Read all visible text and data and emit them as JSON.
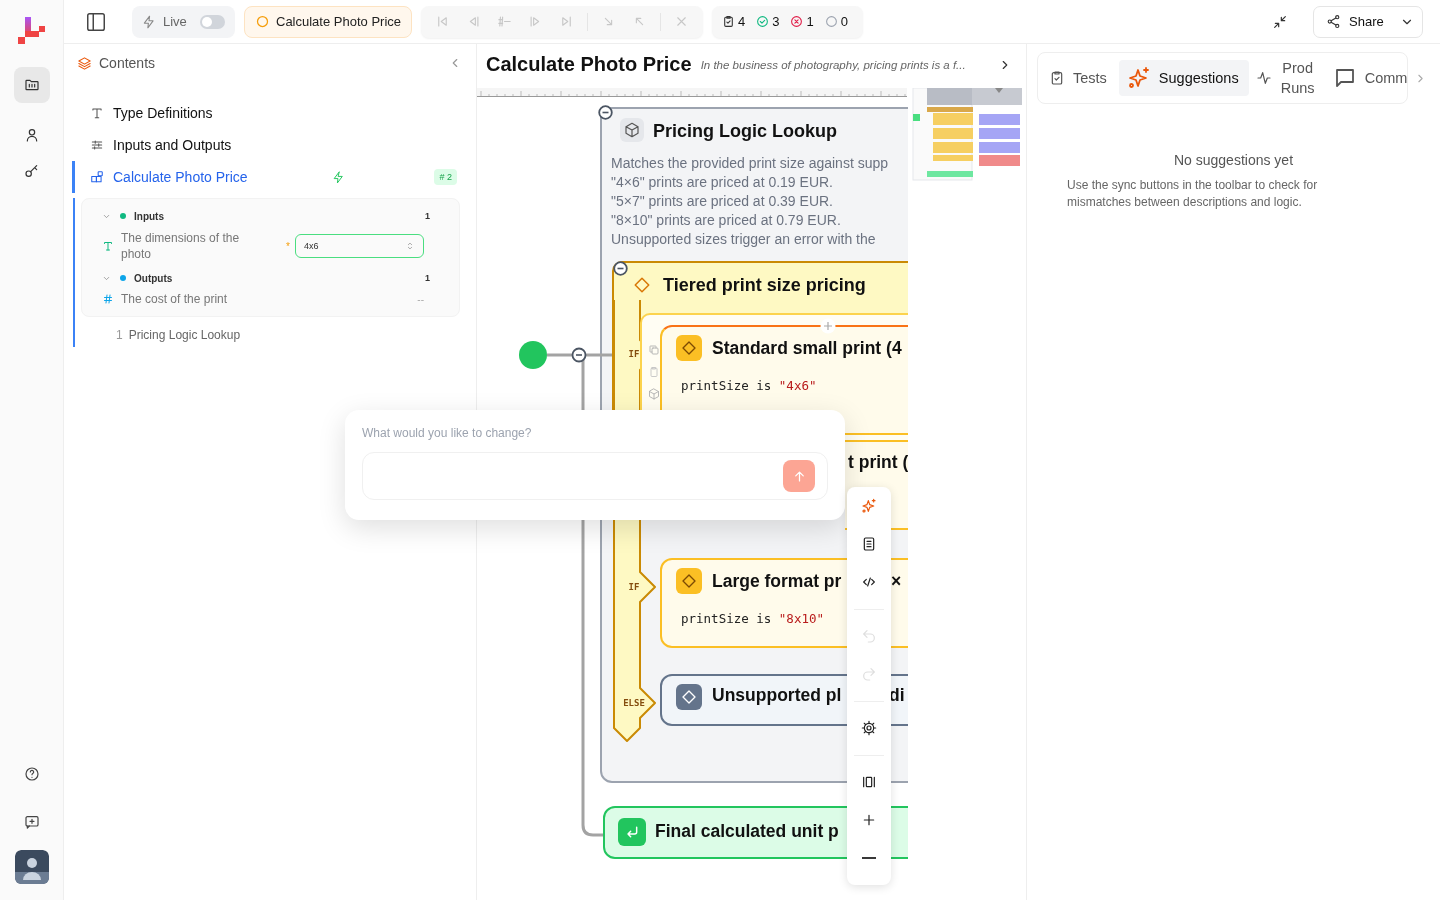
{
  "rail": {
    "items": [
      {
        "kind": "files",
        "selected": true
      },
      {
        "kind": "people",
        "selected": false
      },
      {
        "kind": "keys",
        "selected": false
      }
    ],
    "footer": [
      {
        "kind": "help"
      },
      {
        "kind": "feedback"
      },
      {
        "kind": "avatar"
      }
    ]
  },
  "top_bar": {
    "live": {
      "label": "Live",
      "on": false
    },
    "current": "Calculate Photo Price",
    "navigation": [
      {
        "kind": "first",
        "disabled": true
      },
      {
        "kind": "prev",
        "disabled": true
      },
      {
        "kind": "line",
        "disabled": true
      },
      {
        "kind": "next",
        "disabled": true
      },
      {
        "kind": "last",
        "disabled": true
      },
      {
        "kind": "step_in",
        "disabled": true
      },
      {
        "kind": "step_out",
        "disabled": true
      },
      {
        "kind": "stop",
        "disabled": true
      }
    ],
    "counts": [
      {
        "kind": "total",
        "value": "4"
      },
      {
        "kind": "passed",
        "value": "3"
      },
      {
        "kind": "failed",
        "value": "1"
      },
      {
        "kind": "pending",
        "value": "0"
      }
    ],
    "share": "Share"
  },
  "contents": {
    "title": "Contents",
    "items": [
      {
        "kind": "types",
        "label": "Type Definitions",
        "selected": false
      },
      {
        "kind": "io",
        "label": "Inputs and Outputs",
        "selected": false
      },
      {
        "kind": "function",
        "label": "Calculate Photo Price",
        "selected": true,
        "badge": "# 2",
        "expanded": true,
        "sections": [
          {
            "kind": "inputs",
            "label": "Inputs",
            "count": "1",
            "expanded": true,
            "fields": [
              {
                "kind": "text",
                "label": "The dimensions of the photo",
                "required_mark": "*",
                "value": "4x6"
              }
            ]
          },
          {
            "kind": "outputs",
            "label": "Outputs",
            "count": "1",
            "expanded": true,
            "fields": [
              {
                "kind": "number",
                "label": "The cost of the print",
                "value": "--"
              }
            ]
          }
        ],
        "steps": [
          {
            "number": "1",
            "label": "Pricing Logic Lookup"
          }
        ]
      }
    ]
  },
  "canvas": {
    "title": "Calculate Photo Price",
    "summary": "In the business of photography, pricing prints is a f...",
    "group": {
      "title": "Pricing Logic Lookup",
      "description": [
        "Matches the provided print size against supp",
        "\"4×6\" prints are priced at 0.19 EUR.",
        "\"5×7\" prints are priced at 0.39 EUR.",
        "\"8×10\" prints are priced at 0.79 EUR.",
        "Unsupported sizes trigger an error with the"
      ],
      "decision": {
        "title": "Tiered print size pricing",
        "branches": [
          {
            "kind": "match",
            "label": "IF",
            "title": "Standard small print (4",
            "condition": "printSize is",
            "literal": "\"4x6\"",
            "focused": true
          },
          {
            "kind": "covered",
            "title": "t print ("
          },
          {
            "kind": "match",
            "label": "IF",
            "title": "Large format pr",
            "tail": "×",
            "condition": "printSize is",
            "literal": "\"8x10\"",
            "focused": false
          },
          {
            "kind": "fallback",
            "label": "ELSE",
            "title": "Unsupported pl",
            "tail": "di"
          }
        ]
      }
    },
    "result": {
      "title": "Final calculated unit p"
    }
  },
  "assistant": {
    "prompt": "What would you like to change?"
  },
  "tools": [
    {
      "kind": "suggest",
      "disabled": false
    },
    {
      "kind": "docs",
      "disabled": false
    },
    {
      "kind": "code",
      "disabled": false
    },
    {
      "kind": "undo",
      "disabled": true
    },
    {
      "kind": "redo",
      "disabled": true
    },
    {
      "kind": "settings",
      "disabled": false
    },
    {
      "kind": "fit",
      "disabled": false
    },
    {
      "kind": "zoom_in",
      "disabled": false
    },
    {
      "kind": "zoom_out",
      "disabled": false
    }
  ],
  "side_panel": {
    "tabs": [
      {
        "kind": "tests",
        "label": "Tests",
        "selected": false
      },
      {
        "kind": "suggestions",
        "label": "Suggestions",
        "selected": true
      },
      {
        "kind": "runs",
        "label": "Prod Runs",
        "selected": false
      },
      {
        "kind": "comments",
        "label": "Comm",
        "selected": false
      }
    ],
    "empty": {
      "title": "No suggestions yet",
      "body": "Use the sync buttons in the toolbar to check for mismatches between descriptions and logic."
    }
  }
}
